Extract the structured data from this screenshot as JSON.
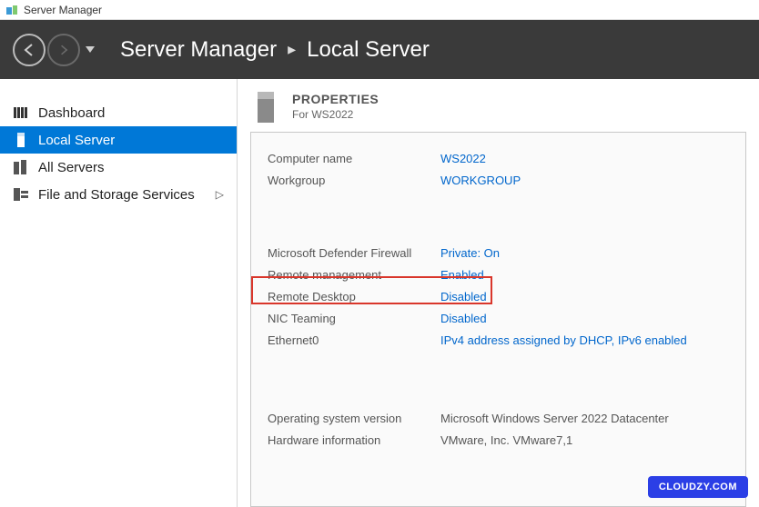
{
  "titlebar": {
    "title": "Server Manager"
  },
  "header": {
    "crumb1": "Server Manager",
    "crumb2": "Local Server"
  },
  "sidebar": {
    "items": [
      {
        "label": "Dashboard"
      },
      {
        "label": "Local Server"
      },
      {
        "label": "All Servers"
      },
      {
        "label": "File and Storage Services"
      }
    ]
  },
  "props": {
    "heading": "PROPERTIES",
    "sub": "For WS2022",
    "rows": {
      "computer_name_label": "Computer name",
      "computer_name_value": "WS2022",
      "workgroup_label": "Workgroup",
      "workgroup_value": "WORKGROUP",
      "firewall_label": "Microsoft Defender Firewall",
      "firewall_value": "Private: On",
      "remote_mgmt_label": "Remote management",
      "remote_mgmt_value": "Enabled",
      "remote_desktop_label": "Remote Desktop",
      "remote_desktop_value": "Disabled",
      "nic_teaming_label": "NIC Teaming",
      "nic_teaming_value": "Disabled",
      "ethernet_label": "Ethernet0",
      "ethernet_value": "IPv4 address assigned by DHCP, IPv6 enabled",
      "os_version_label": "Operating system version",
      "os_version_value": "Microsoft Windows Server 2022 Datacenter",
      "hardware_label": "Hardware information",
      "hardware_value": "VMware, Inc. VMware7,1"
    }
  },
  "badge": {
    "label": "CLOUDZY.COM"
  }
}
